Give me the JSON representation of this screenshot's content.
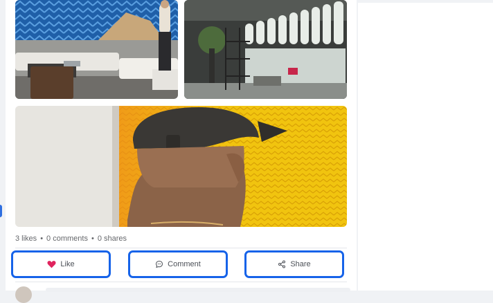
{
  "post": {
    "images": [
      {
        "name": "photo-gallery-wall-sofa",
        "alt_icon": "photo"
      },
      {
        "name": "photo-loft-windows",
        "alt_icon": "photo"
      },
      {
        "name": "photo-man-cap-yellow-art",
        "alt_icon": "photo"
      }
    ],
    "stats": {
      "likes": "3 likes",
      "separator": "•",
      "comments": "0 comments",
      "shares": "0 shares"
    },
    "actions": {
      "like": {
        "label": "Like",
        "icon": "heart-icon",
        "color": "#e0245e"
      },
      "comment": {
        "label": "Comment",
        "icon": "comment-icon"
      },
      "share": {
        "label": "Share",
        "icon": "share-icon"
      }
    },
    "colors": {
      "highlight": "#1663e9",
      "text_muted": "#65676b",
      "page_bg": "#f0f2f5"
    }
  }
}
